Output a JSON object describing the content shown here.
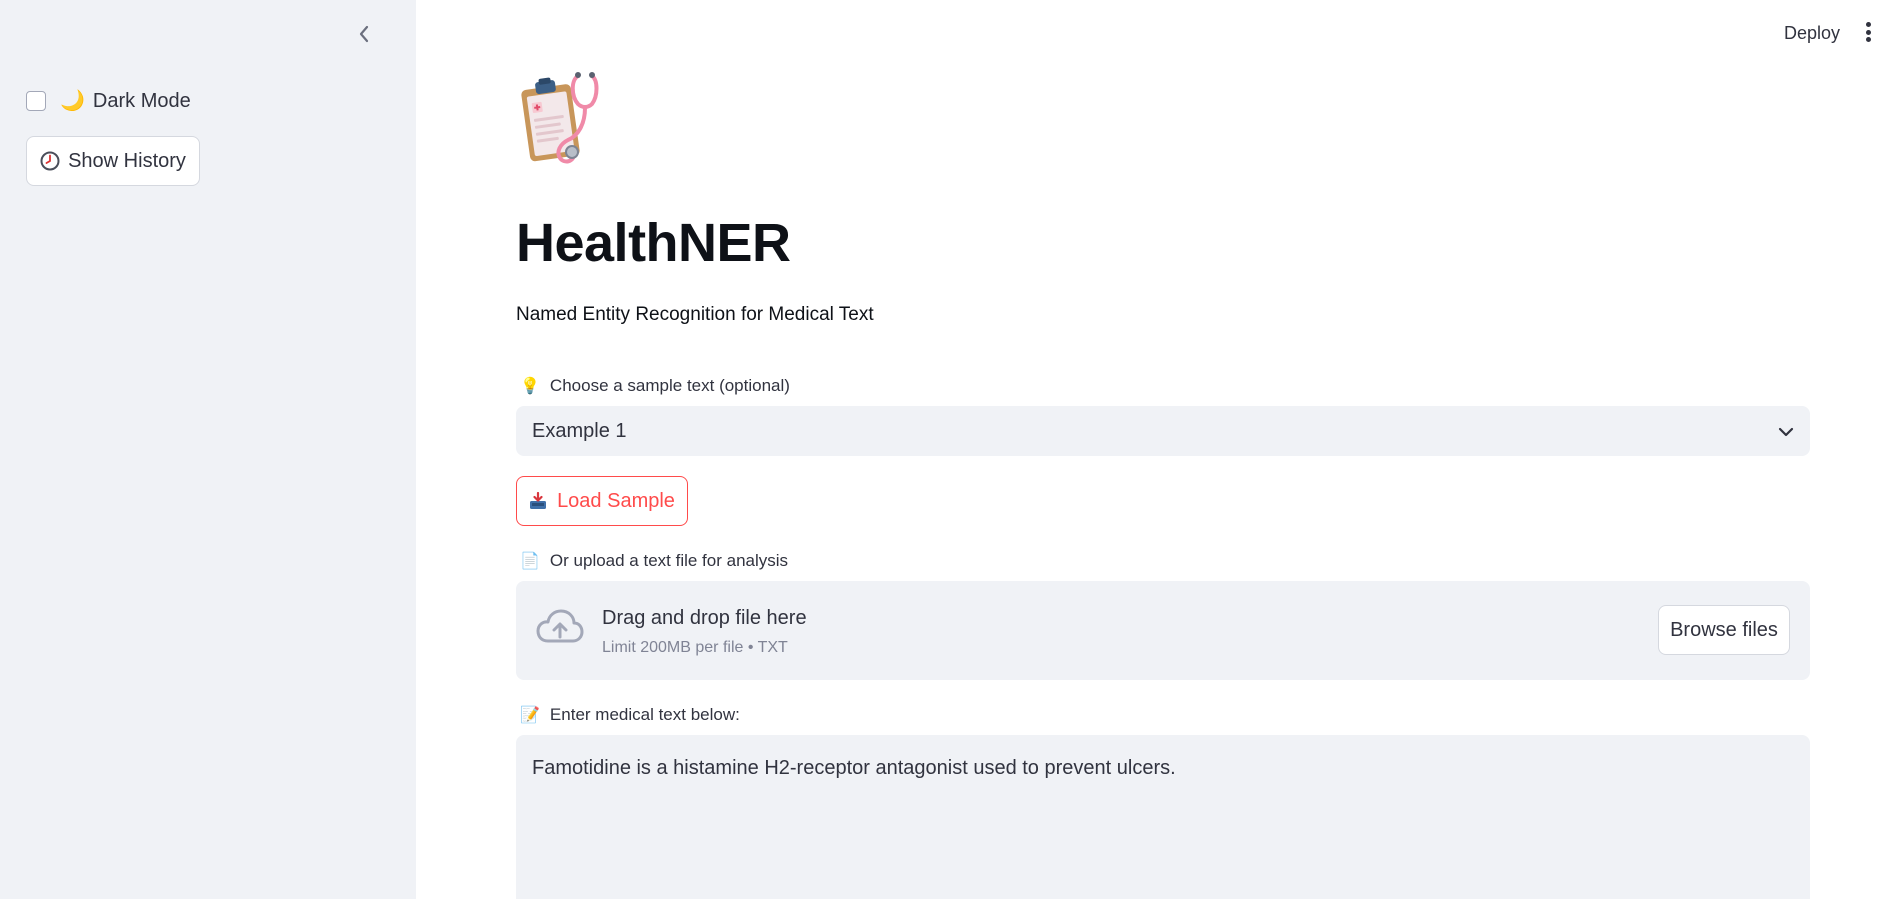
{
  "sidebar": {
    "collapse_icon": "chevron-left-icon",
    "dark_mode": {
      "emoji": "🌙",
      "label": "Dark Mode",
      "checked": false
    },
    "history_button": {
      "icon": "clock-icon",
      "label": "Show History"
    }
  },
  "header": {
    "deploy_label": "Deploy",
    "menu_icon": "kebab-menu-icon"
  },
  "main": {
    "logo_icon": "clipboard-stethoscope-icon",
    "title": "HealthNER",
    "subtitle": "Named Entity Recognition for Medical Text",
    "sample": {
      "label_emoji": "💡",
      "label": "Choose a sample text (optional)",
      "selected": "Example 1"
    },
    "load_button": {
      "icon": "inbox-tray-icon",
      "label": "Load Sample"
    },
    "upload": {
      "label_emoji": "📄",
      "label": "Or upload a text file for analysis",
      "drop_title": "Drag and drop file here",
      "limit": "Limit 200MB per file • TXT",
      "browse_label": "Browse files"
    },
    "text_input": {
      "label_emoji": "📝",
      "label": "Enter medical text below:",
      "value": "Famotidine is a histamine H2-receptor antagonist used to prevent ulcers."
    }
  },
  "colors": {
    "sidebar_bg": "#f0f2f6",
    "accent": "#ff4b4b",
    "text": "#31333f",
    "heading": "#0e1117"
  }
}
